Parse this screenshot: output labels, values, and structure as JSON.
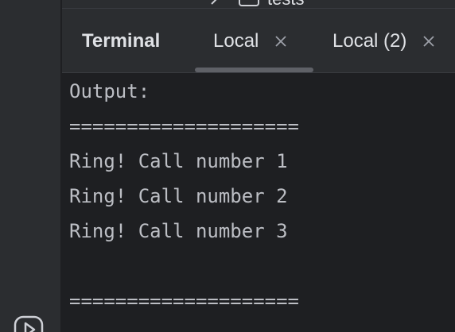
{
  "project_tree": {
    "visible_item_label": "tests",
    "chevron_icon": "chevron-right-icon",
    "folder_icon": "folder-icon"
  },
  "tool_window": {
    "title": "Terminal",
    "tabs": [
      {
        "label": "Local",
        "active": true,
        "close_icon": "close-icon"
      },
      {
        "label": "Local (2)",
        "active": false,
        "close_icon": "close-icon"
      }
    ]
  },
  "terminal": {
    "lines": [
      "Output:",
      "====================",
      "Ring! Call number 1",
      "Ring! Call number 2",
      "Ring! Call number 3",
      "",
      "===================="
    ]
  },
  "sidebar": {
    "run_icon": "run-icon"
  },
  "colors": {
    "background": "#1e1f22",
    "panel": "#2b2d30",
    "text": "#bcbec4",
    "tab_text": "#dfe1e5",
    "active_tab_indicator": "#5f6167"
  }
}
